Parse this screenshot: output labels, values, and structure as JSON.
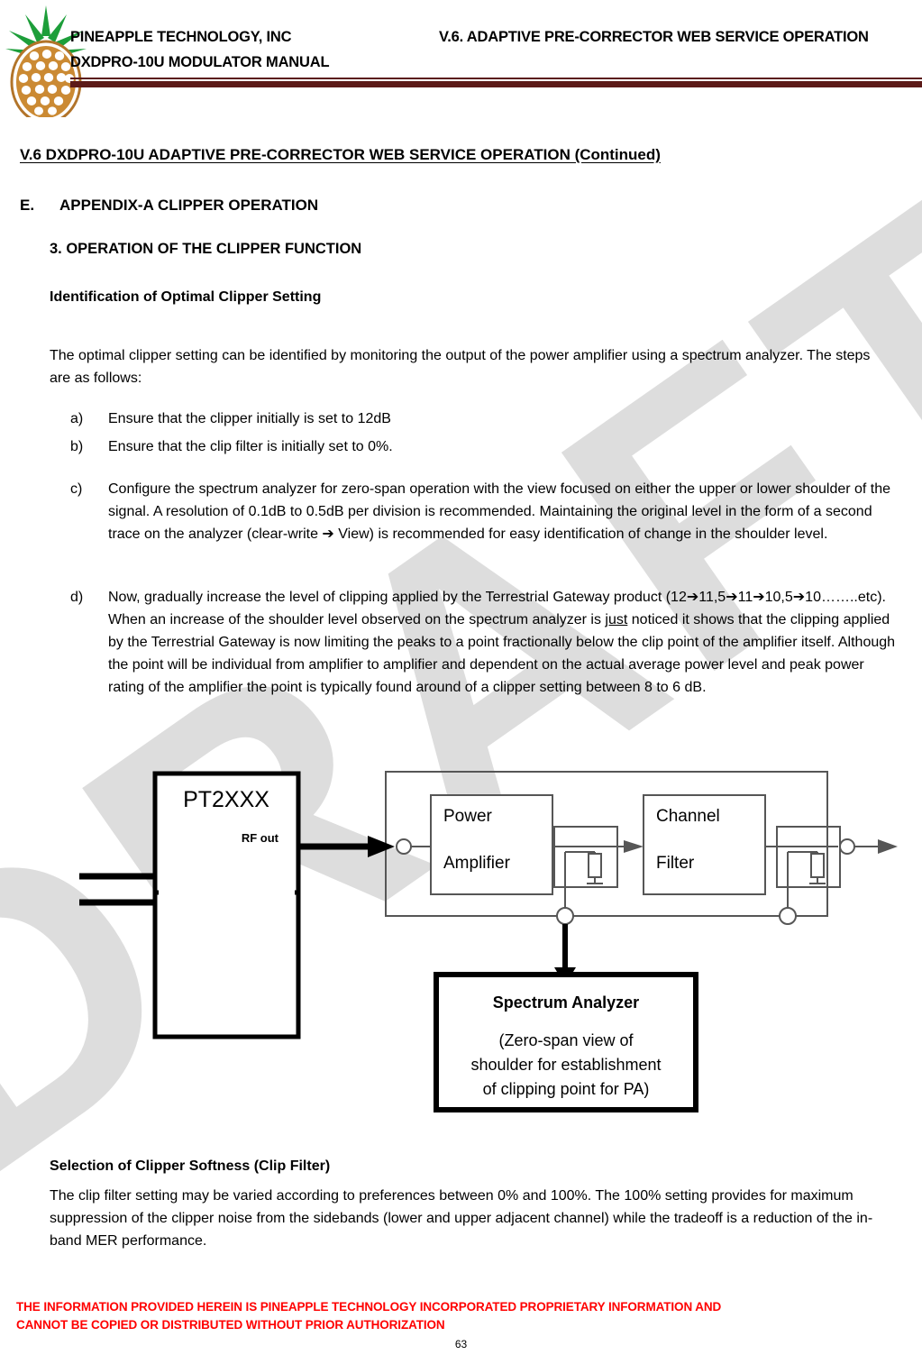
{
  "header": {
    "company": "PINEAPPLE TECHNOLOGY, INC",
    "manual": "DXDPRO-10U MODULATOR MANUAL",
    "section": "V.6. ADAPTIVE PRE-CORRECTOR WEB SERVICE OPERATION",
    "logo_icon": "pineapple-logo-icon",
    "rule_color": "#5c1a18"
  },
  "watermark": {
    "text": "DRAFT",
    "color": "#dddddd"
  },
  "headings": {
    "v6": "V.6  DXDPRO-10U ADAPTIVE PRE-CORRECTOR WEB SERVICE OPERATION (Continued)",
    "appendix_label": "E.",
    "appendix_title": "APPENDIX-A    CLIPPER OPERATION",
    "operation": "3. OPERATION OF THE CLIPPER FUNCTION",
    "identification": "Identification of Optimal Clipper Setting",
    "softness": "Selection of Clipper Softness (Clip Filter)"
  },
  "paragraphs": {
    "intro": "The optimal clipper setting can be identified by monitoring the output of the power amplifier using a spectrum analyzer. The steps are as follows:",
    "clip_filter": "The clip filter setting may be varied according to preferences between 0% and 100%. The 100% setting provides for maximum suppression of the clipper noise from the sidebands (lower and upper adjacent channel) while the tradeoff is a reduction of the in-band MER performance."
  },
  "steps": [
    {
      "marker": "a)",
      "text": "Ensure that the clipper initially is set to 12dB"
    },
    {
      "marker": "b)",
      "text": "Ensure that the clip filter is initially set to 0%."
    },
    {
      "marker": "c)",
      "text": "Configure the spectrum analyzer for zero-span operation with the view focused on either the upper or lower shoulder of the signal. A resolution of 0.1dB to 0.5dB per division is recommended. Maintaining the original level in the form of a second trace on the analyzer (clear-write ➔ View) is recommended for easy identification of change in the shoulder level."
    },
    {
      "marker": "d)",
      "part1": "Now, gradually increase the level of clipping applied by the Terrestrial Gateway product (12➔11,5➔11➔10,5➔10……..etc). When an increase of the shoulder level observed on the spectrum analyzer is ",
      "underlined": "just",
      "part2": " noticed it shows that the clipping applied by the Terrestrial Gateway is now limiting the peaks to a point fractionally below the clip point of the amplifier itself. Although the point will be individual from amplifier to amplifier and dependent on the actual average power level and peak power rating of the amplifier the point is typically found around of a clipper setting between 8 to 6 dB."
    }
  ],
  "diagram": {
    "modulator_title": "PT2XXX",
    "rf_out_label": "RF out",
    "power_amplifier_line1": "Power",
    "power_amplifier_line2": "Amplifier",
    "channel_filter_line1": "Channel",
    "channel_filter_line2": "Filter",
    "spectrum_analyzer_title": "Spectrum Analyzer",
    "spectrum_analyzer_note_line1": "(Zero-span view of",
    "spectrum_analyzer_note_line2": "shoulder for establishment",
    "spectrum_analyzer_note_line3": "of clipping point for PA)",
    "line_color": "#565656",
    "bold_line_color": "#000000"
  },
  "footer": {
    "line1": "THE INFORMATION PROVIDED HEREIN IS PINEAPPLE TECHNOLOGY INCORPORATED PROPRIETARY INFORMATION AND",
    "line2": "CANNOT BE COPIED OR DISTRIBUTED WITHOUT PRIOR AUTHORIZATION",
    "page_number": "63",
    "color": "#ff0000"
  }
}
